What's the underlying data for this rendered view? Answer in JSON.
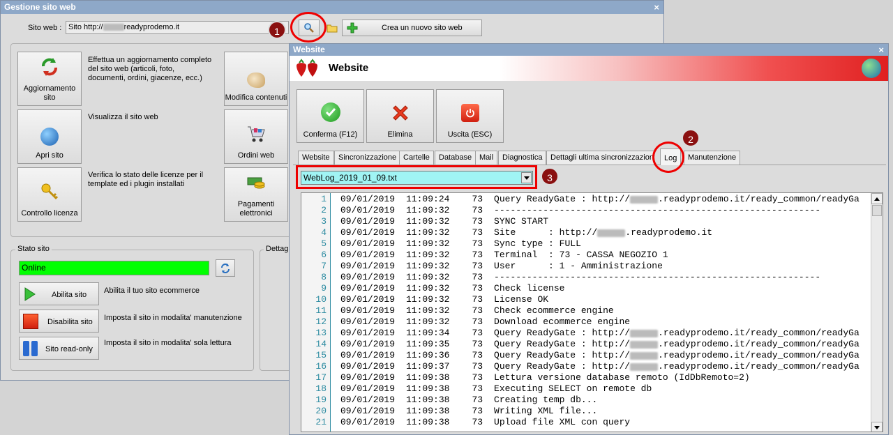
{
  "main_window": {
    "title": "Gestione sito web",
    "close": "×",
    "site_label": "Sito web :",
    "site_prefix": "Sito http://",
    "site_suffix": "readyprodemo.it",
    "create_button": "Crea un nuovo sito web",
    "actions": {
      "update": {
        "label": "Aggiornamento sito",
        "desc": "Effettua un aggiornamento completo del sito web (articoli, foto, documenti, ordini, giacenze, ecc.)"
      },
      "open": {
        "label": "Apri sito",
        "desc": "Visualizza il sito web"
      },
      "license": {
        "label": "Controllo licenza",
        "desc": "Verifica lo stato delle licenze per il template ed i plugin installati"
      },
      "edit": {
        "label": "Modifica contenuti"
      },
      "orders": {
        "label": "Ordini web"
      },
      "payments": {
        "label": "Pagamenti elettronici"
      }
    },
    "status": {
      "group_title": "Stato sito",
      "value": "Online",
      "details_title": "Dettag",
      "enable_button": "Abilita sito",
      "enable_desc": "Abilita il tuo sito ecommerce",
      "disable_button": "Disabilita sito",
      "disable_desc": "Imposta il sito in modalita' manutenzione",
      "readonly_button": "Sito read-only",
      "readonly_desc": "Imposta il sito in modalita' sola lettura"
    }
  },
  "website_dialog": {
    "title": "Website",
    "close": "×",
    "header_title": "Website",
    "toolbar": {
      "confirm": "Conferma (F12)",
      "delete": "Elimina",
      "exit": "Uscita (ESC)"
    },
    "tabs": [
      "Website",
      "Sincronizzazione",
      "Cartelle",
      "Database",
      "Mail",
      "Diagnostica",
      "Dettagli ultima sincronizzazione",
      "Log",
      "Manutenzione"
    ],
    "log_file": "WebLog_2019_01_09.txt",
    "log_lines": [
      {
        "n": "1",
        "date": "09/01/2019",
        "time": "11:09:24",
        "term": "73",
        "msg": "Query ReadyGate : http://",
        "blur": true,
        "tail": ".readyprodemo.it/ready_common/readyGa"
      },
      {
        "n": "2",
        "date": "09/01/2019",
        "time": "11:09:32",
        "term": "73",
        "msg": "------------------------------------------------------------"
      },
      {
        "n": "3",
        "date": "09/01/2019",
        "time": "11:09:32",
        "term": "73",
        "msg": "SYNC START"
      },
      {
        "n": "4",
        "date": "09/01/2019",
        "time": "11:09:32",
        "term": "73",
        "msg": "Site      : http://",
        "blur": true,
        "tail": ".readyprodemo.it"
      },
      {
        "n": "5",
        "date": "09/01/2019",
        "time": "11:09:32",
        "term": "73",
        "msg": "Sync type : FULL"
      },
      {
        "n": "6",
        "date": "09/01/2019",
        "time": "11:09:32",
        "term": "73",
        "msg": "Terminal  : 73 - CASSA NEGOZIO 1"
      },
      {
        "n": "7",
        "date": "09/01/2019",
        "time": "11:09:32",
        "term": "73",
        "msg": "User      : 1 - Amministrazione"
      },
      {
        "n": "8",
        "date": "09/01/2019",
        "time": "11:09:32",
        "term": "73",
        "msg": "------------------------------------------------------------"
      },
      {
        "n": "9",
        "date": "09/01/2019",
        "time": "11:09:32",
        "term": "73",
        "msg": "Check license"
      },
      {
        "n": "10",
        "date": "09/01/2019",
        "time": "11:09:32",
        "term": "73",
        "msg": "License OK"
      },
      {
        "n": "11",
        "date": "09/01/2019",
        "time": "11:09:32",
        "term": "73",
        "msg": "Check ecommerce engine"
      },
      {
        "n": "12",
        "date": "09/01/2019",
        "time": "11:09:32",
        "term": "73",
        "msg": "Download ecommerce engine"
      },
      {
        "n": "13",
        "date": "09/01/2019",
        "time": "11:09:34",
        "term": "73",
        "msg": "Query ReadyGate : http://",
        "blur": true,
        "tail": ".readyprodemo.it/ready_common/readyGa"
      },
      {
        "n": "14",
        "date": "09/01/2019",
        "time": "11:09:35",
        "term": "73",
        "msg": "Query ReadyGate : http://",
        "blur": true,
        "tail": ".readyprodemo.it/ready_common/readyGa"
      },
      {
        "n": "15",
        "date": "09/01/2019",
        "time": "11:09:36",
        "term": "73",
        "msg": "Query ReadyGate : http://",
        "blur": true,
        "tail": ".readyprodemo.it/ready_common/readyGa"
      },
      {
        "n": "16",
        "date": "09/01/2019",
        "time": "11:09:37",
        "term": "73",
        "msg": "Query ReadyGate : http://",
        "blur": true,
        "tail": ".readyprodemo.it/ready_common/readyGa"
      },
      {
        "n": "17",
        "date": "09/01/2019",
        "time": "11:09:38",
        "term": "73",
        "msg": "Lettura versione database remoto (IdDbRemoto=2)"
      },
      {
        "n": "18",
        "date": "09/01/2019",
        "time": "11:09:38",
        "term": "73",
        "msg": "Executing SELECT on remote db"
      },
      {
        "n": "19",
        "date": "09/01/2019",
        "time": "11:09:38",
        "term": "73",
        "msg": "Creating temp db..."
      },
      {
        "n": "20",
        "date": "09/01/2019",
        "time": "11:09:38",
        "term": "73",
        "msg": "Writing XML file..."
      },
      {
        "n": "21",
        "date": "09/01/2019",
        "time": "11:09:38",
        "term": "73",
        "msg": "Upload file XML con query"
      }
    ]
  },
  "callouts": [
    "1",
    "2",
    "3"
  ],
  "colors": {
    "title_bar": "#8ea8c8",
    "online": "#00ff00",
    "highlight": "#e00000",
    "badge": "#8a1010",
    "combo_bg": "#a0f4f4"
  }
}
